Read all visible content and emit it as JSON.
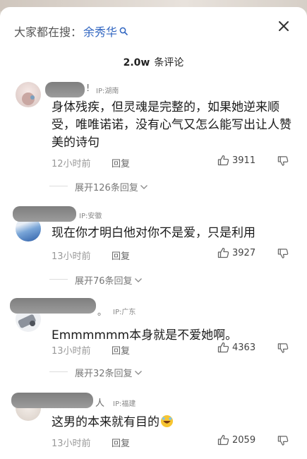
{
  "search": {
    "prefix": "大家都在搜：",
    "keyword": "余秀华"
  },
  "header": {
    "count": "2.0w",
    "label": "条评论"
  },
  "comments": [
    {
      "name_tail": "!",
      "ip": "IP:湖南",
      "text": "身体残疾，但灵魂是完整的，如果她逆来顺受，唯唯诺诺，没有心气又怎么能写出让人赞美的诗句",
      "time": "12小时前",
      "reply": "回复",
      "likes": "3911",
      "expand": "展开126条回复"
    },
    {
      "name_tail": "",
      "ip": "IP:安徽",
      "text": "现在你才明白他对你不是爱，只是利用",
      "time": "13小时前",
      "reply": "回复",
      "likes": "3927",
      "expand": "展开76条回复"
    },
    {
      "name_tail": "。",
      "ip": "IP:广东",
      "text": "Emmmmmm本身就是不爱她啊。",
      "time": "13小时前",
      "reply": "回复",
      "likes": "4363",
      "expand": "展开32条回复"
    },
    {
      "name_tail": "人",
      "ip": "IP:福建",
      "text": "这男的本来就有目的",
      "emoji": "rofl-emoji",
      "time": "13小时前",
      "reply": "回复",
      "likes": "2059"
    }
  ],
  "icons": {
    "search": "search-icon",
    "close": "close-icon",
    "like": "thumbs-up-icon",
    "dislike": "thumbs-down-icon",
    "expand": "chevron-down-icon"
  },
  "colors": {
    "keyword": "#2f64c0",
    "muted": "#999999",
    "text": "#1a1a1a"
  }
}
